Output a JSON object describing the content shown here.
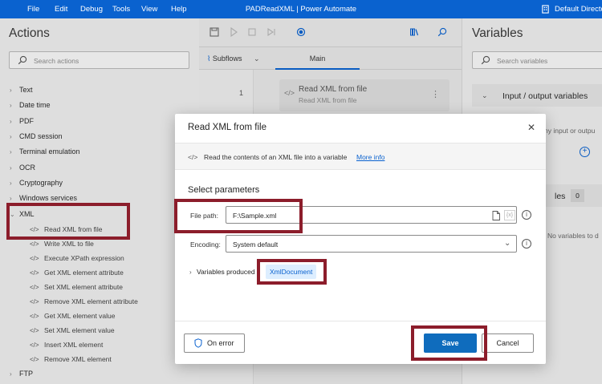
{
  "menu": [
    "File",
    "Edit",
    "Debug",
    "Tools",
    "View",
    "Help"
  ],
  "app_title": "PADReadXML | Power Automate",
  "user": "Default Director",
  "actions": {
    "title": "Actions",
    "search_placeholder": "Search actions",
    "groups": [
      "Text",
      "Date time",
      "PDF",
      "CMD session",
      "Terminal emulation",
      "OCR",
      "Cryptography",
      "Windows services",
      "XML",
      "FTP"
    ],
    "xml_items": [
      "Read XML from file",
      "Write XML to file",
      "Execute XPath expression",
      "Get XML element attribute",
      "Set XML element attribute",
      "Remove XML element attribute",
      "Get XML element value",
      "Set XML element value",
      "Insert XML element",
      "Remove XML element"
    ]
  },
  "designer": {
    "subflows_label": "Subflows",
    "main_tab": "Main",
    "line_number": "1",
    "step_title": "Read XML from file",
    "step_subtitle": "Read XML from file"
  },
  "variables": {
    "title": "Variables",
    "search_placeholder": "Search variables",
    "io_header": "Input / output variables",
    "io_note": "ny input or outpu",
    "flow_header": "les",
    "flow_count": "0",
    "no_vars": "No variables to d"
  },
  "dialog": {
    "title": "Read XML from file",
    "description": "Read the contents of an XML file into a variable",
    "more_info": "More info",
    "section": "Select parameters",
    "file_path_label": "File path:",
    "file_path_value": "F:\\Sample.xml",
    "encoding_label": "Encoding:",
    "encoding_value": "System default",
    "variables_produced_label": "Variables produced",
    "variable_name": "XmlDocument",
    "on_error": "On error",
    "save": "Save",
    "cancel": "Cancel"
  },
  "colors": {
    "accent": "#0a62cf",
    "save_button": "#0f6cbd",
    "highlight": "#8c1d2b"
  }
}
